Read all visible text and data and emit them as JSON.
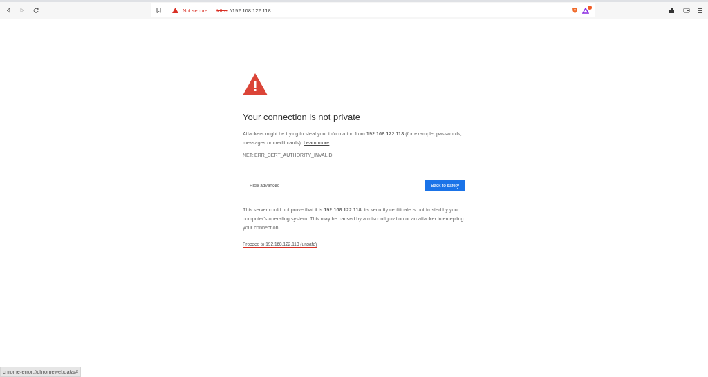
{
  "toolbar": {
    "security_label": "Not secure",
    "url_scheme": "https",
    "url_rest": "://192.168.122.118",
    "notification_badge": true
  },
  "page": {
    "title": "Your connection is not private",
    "message": "Attackers might be trying to steal your information from **192.168.122.118** (for example, passwords, messages or credit cards).",
    "learn_more": "Learn more",
    "error_code": "NET::ERR_CERT_AUTHORITY_INVALID",
    "advanced_button": {
      "label": "Hide advanced",
      "highlighted": true
    },
    "safety_button": "Back to safety",
    "details": "This server could not prove that it is **192.168.122.118**; its security certificate is not trusted by your computer's operating system. This may be caused by a misconfiguration or an attacker intercepting your connection.",
    "proceed_link": {
      "label": "Proceed to 192.168.122.118 (unsafe)",
      "highlighted": true
    }
  },
  "status_bar": "chrome-error://chromewebdata/#"
}
